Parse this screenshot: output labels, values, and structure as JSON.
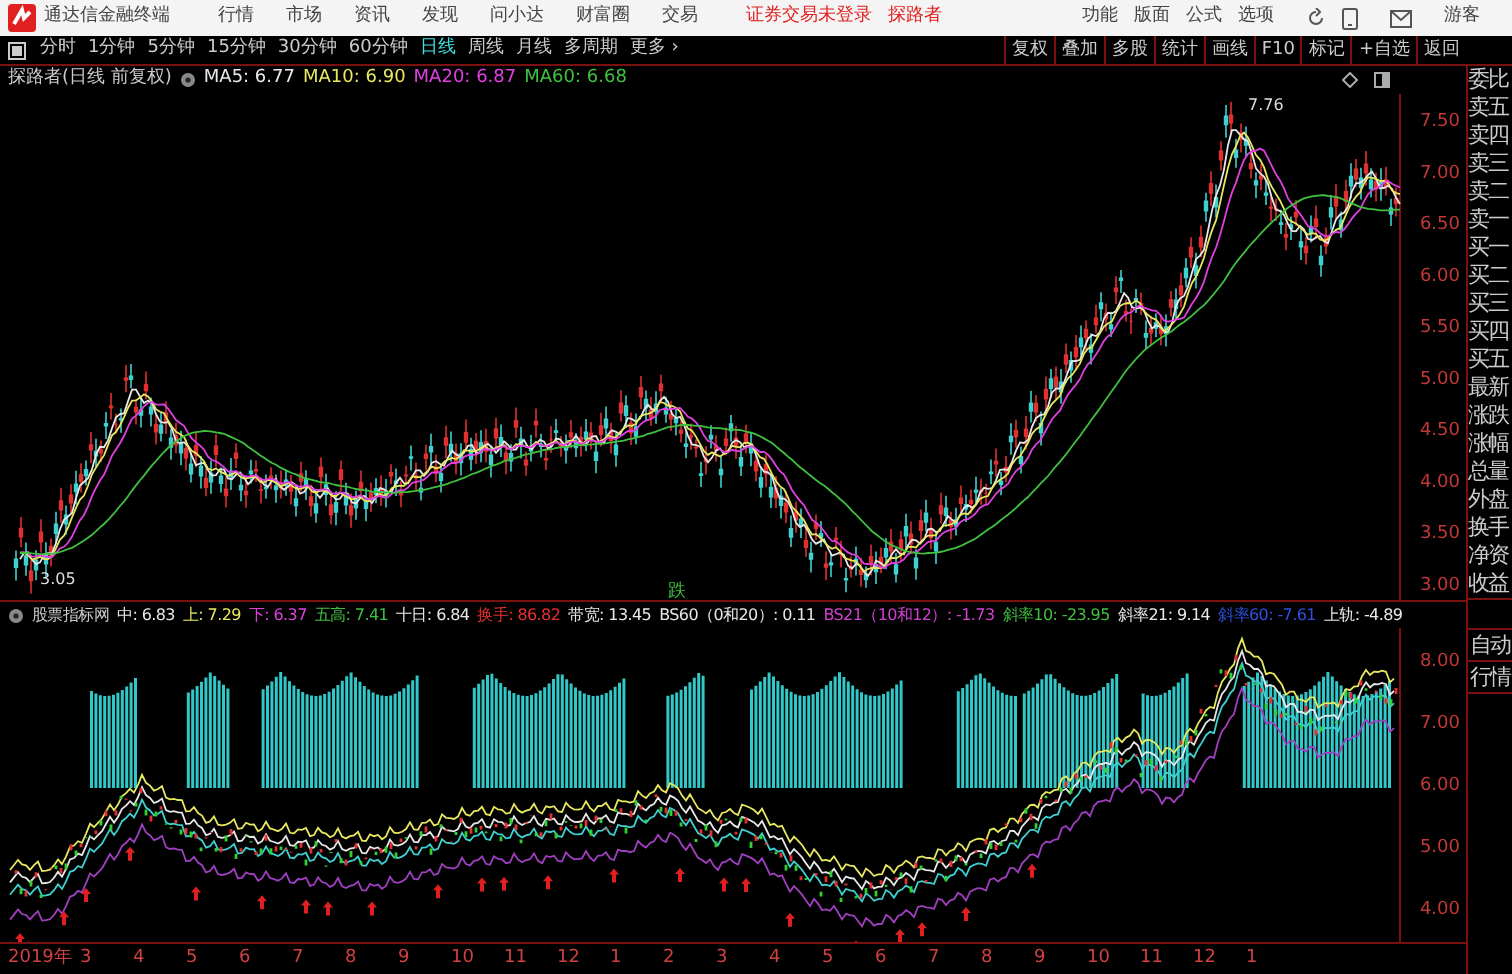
{
  "menu_bar": {
    "app_title": "通达信金融终端",
    "menus": [
      "行情",
      "市场",
      "资讯",
      "发现",
      "问小达",
      "财富圈",
      "交易"
    ],
    "login_status": "证券交易未登录",
    "stock_name": "探路者",
    "right_menus": [
      "功能",
      "版面",
      "公式",
      "选项"
    ],
    "user": "游客"
  },
  "period_tabs": [
    {
      "label": "分时",
      "selected": false
    },
    {
      "label": "1分钟",
      "selected": false
    },
    {
      "label": "5分钟",
      "selected": false
    },
    {
      "label": "15分钟",
      "selected": false
    },
    {
      "label": "30分钟",
      "selected": false
    },
    {
      "label": "60分钟",
      "selected": false
    },
    {
      "label": "日线",
      "selected": true
    },
    {
      "label": "周线",
      "selected": false
    },
    {
      "label": "月线",
      "selected": false
    },
    {
      "label": "多周期",
      "selected": false
    },
    {
      "label": "更多 ›",
      "selected": false
    }
  ],
  "toolbar_buttons": [
    "复权",
    "叠加",
    "多股",
    "统计",
    "画线",
    "F10",
    "标记",
    "+自选",
    "返回"
  ],
  "main_chart": {
    "title": "探路者(日线 前复权)",
    "legend": [
      {
        "text": "MA5: 6.77",
        "color": "#e8e8e8"
      },
      {
        "text": "MA10: 6.90",
        "color": "#e8e860"
      },
      {
        "text": "MA20: 6.87",
        "color": "#e040e0"
      },
      {
        "text": "MA60: 6.68",
        "color": "#40c040"
      }
    ],
    "y_axis": [
      "7.50",
      "7.00",
      "6.50",
      "6.00",
      "5.50",
      "5.00",
      "4.50",
      "4.00",
      "3.50",
      "3.00"
    ],
    "high_label": "7.76",
    "low_label": "3.05",
    "signal_label": "跌"
  },
  "quote_panel": [
    "委比",
    "卖五",
    "卖四",
    "卖三",
    "卖二",
    "卖一",
    "买一",
    "买二",
    "买三",
    "买四",
    "买五",
    "最新",
    "涨跌",
    "涨幅",
    "总量",
    "外盘",
    "换手",
    "净资",
    "收益"
  ],
  "indicator": {
    "name": "股票指标网",
    "values": [
      {
        "text": "中: 6.83",
        "color": "#e8e8e8"
      },
      {
        "text": "上: 7.29",
        "color": "#e8e860"
      },
      {
        "text": "下: 6.37",
        "color": "#e040e0"
      },
      {
        "text": "五高: 7.41",
        "color": "#40c040"
      },
      {
        "text": "十日: 6.84",
        "color": "#e8e8e8"
      },
      {
        "text": "换手: 86.82",
        "color": "#e83030"
      },
      {
        "text": "带宽: 13.45",
        "color": "#e8e8e8"
      },
      {
        "text": "BS60（0和20）: 0.11",
        "color": "#e8e8e8"
      },
      {
        "text": "BS21（10和12）: -1.73",
        "color": "#d040d0"
      },
      {
        "text": "斜率10: -23.95",
        "color": "#40c040"
      },
      {
        "text": "斜率21: 9.14",
        "color": "#e8e8e8"
      },
      {
        "text": "斜率60: -7.61",
        "color": "#3050e0"
      },
      {
        "text": "上轨: -4.89",
        "color": "#e8e8e8"
      }
    ],
    "y_axis": [
      "8.00",
      "7.00",
      "6.00",
      "5.00",
      "4.00"
    ]
  },
  "side_buttons": [
    "自动",
    "行情"
  ],
  "date_axis": [
    "2019年",
    "3",
    "4",
    "5",
    "6",
    "7",
    "8",
    "9",
    "10",
    "11",
    "12",
    "1",
    "2",
    "3",
    "4",
    "5",
    "6",
    "7",
    "8",
    "9",
    "10",
    "11",
    "12",
    "1"
  ]
}
